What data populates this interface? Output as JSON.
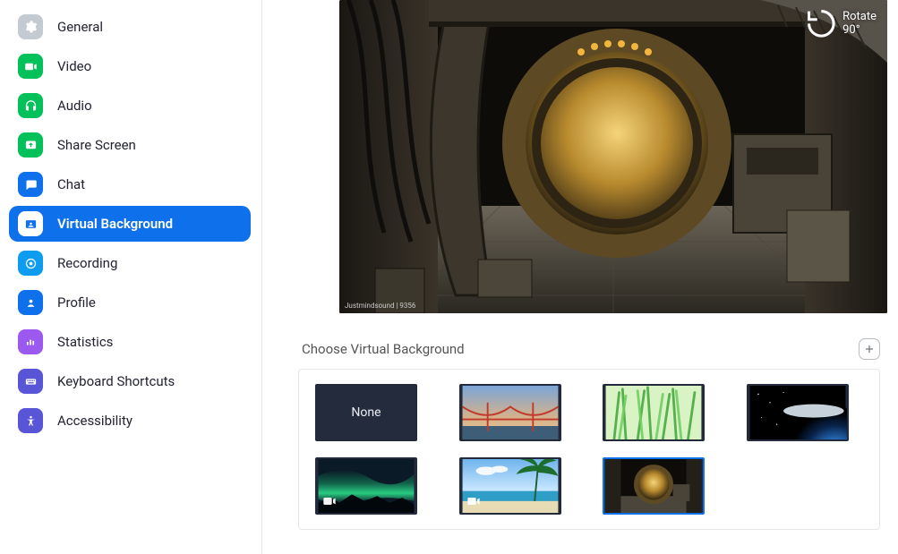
{
  "sidebar": {
    "items": [
      {
        "id": "general",
        "label": "General",
        "iconBg": "#c4cad1"
      },
      {
        "id": "video",
        "label": "Video",
        "iconBg": "#03c15a"
      },
      {
        "id": "audio",
        "label": "Audio",
        "iconBg": "#03c15a"
      },
      {
        "id": "share-screen",
        "label": "Share Screen",
        "iconBg": "#03c15a"
      },
      {
        "id": "chat",
        "label": "Chat",
        "iconBg": "#0e71eb"
      },
      {
        "id": "virtual-background",
        "label": "Virtual Background",
        "iconBg": "#0e71eb"
      },
      {
        "id": "recording",
        "label": "Recording",
        "iconBg": "#0e9cf0"
      },
      {
        "id": "profile",
        "label": "Profile",
        "iconBg": "#0e71eb"
      },
      {
        "id": "statistics",
        "label": "Statistics",
        "iconBg": "#9b59f0"
      },
      {
        "id": "keyboard-shortcuts",
        "label": "Keyboard Shortcuts",
        "iconBg": "#5856d6"
      },
      {
        "id": "accessibility",
        "label": "Accessibility",
        "iconBg": "#5856d6"
      }
    ],
    "activeId": "virtual-background"
  },
  "preview": {
    "rotateLabel": "Rotate 90°",
    "watermark": "Justmindsound | 9356"
  },
  "chooser": {
    "heading": "Choose Virtual Background",
    "noneLabel": "None",
    "selectedIndex": 6,
    "thumbs": [
      {
        "id": "none",
        "kind": "none"
      },
      {
        "id": "golden-gate",
        "kind": "bridge"
      },
      {
        "id": "grass",
        "kind": "grass"
      },
      {
        "id": "space",
        "kind": "space"
      },
      {
        "id": "aurora",
        "kind": "aurora",
        "isVideo": true
      },
      {
        "id": "beach",
        "kind": "beach",
        "isVideo": true
      },
      {
        "id": "spaceship",
        "kind": "spaceship"
      }
    ]
  }
}
